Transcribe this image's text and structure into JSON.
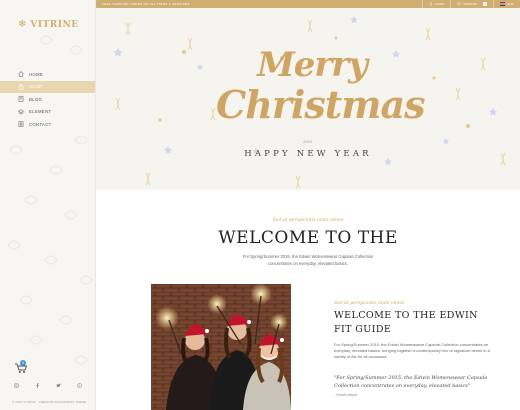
{
  "brand": {
    "logo_text": "VITRINE",
    "logo_icon": "snowflake-icon",
    "accent_color": "#cfae72"
  },
  "topbar": {
    "promo_text": "FREE SHIPPING ORDER ON ALL ITEMS & SERVICES",
    "login_label": "LOGIN",
    "wishlist_label": "WISHLIST",
    "language_label": "ENG"
  },
  "nav": {
    "items": [
      {
        "label": "HOME",
        "icon": "home-icon"
      },
      {
        "label": "SHOP",
        "icon": "bag-icon"
      },
      {
        "label": "BLOG",
        "icon": "book-icon"
      },
      {
        "label": "ELEMENT",
        "icon": "layers-icon"
      },
      {
        "label": "CONTACT",
        "icon": "contact-icon"
      }
    ]
  },
  "cart": {
    "count": "0"
  },
  "socials": [
    "instagram-icon",
    "facebook-icon",
    "twitter-icon",
    "pinterest-icon"
  ],
  "footer": {
    "copyright": "© 2015 VITRINE  ·  PREMIUM WORDPRESS THEME"
  },
  "hero": {
    "line1": "Merry",
    "line2": "Christmas",
    "and": "AND",
    "happy_new_year": "HAPPY NEW YEAR"
  },
  "welcome": {
    "subtitle": "Sed ut perspiciatis unde omnis",
    "title": "WELCOME TO THE",
    "description": "For Spring/Summer 2015, the Edwin Womenswear Capsule Collection concentrates on everyday, elevated basics."
  },
  "fit_guide": {
    "subtitle": "Sed ut perspiciatis unde omnis",
    "title_line1": "WELCOME TO THE EDWIN",
    "title_line2": "FIT GUIDE",
    "description": "For Spring/Summer 2015, the Edwin Womenswear Capsule Collection concentrates on everyday, elevated basics, bringing together a contemporary mix of signature denim in a variety of fits for all occasions.",
    "quote": "\"For Spring/Summer 2015, the Edwin Womenswear Capsule Collection concentrates on everyday, elevated basics\"",
    "author": "- Fonda Mayer"
  }
}
